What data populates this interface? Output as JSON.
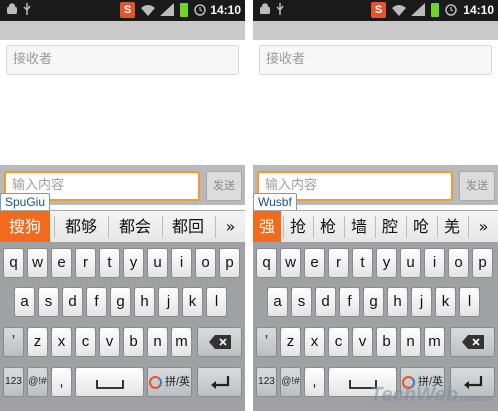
{
  "screens": [
    {
      "statusbar": {
        "sogou_label": "S",
        "time": "14:10"
      },
      "recipient_placeholder": "接收者",
      "message_placeholder": "输入内容",
      "send_label": "发送",
      "pinyin": "SpuGiu",
      "candidates": [
        "搜狗",
        "都够",
        "都会",
        "都回",
        "»"
      ],
      "keyboard": {
        "row1": [
          "q",
          "w",
          "e",
          "r",
          "t",
          "y",
          "u",
          "i",
          "o",
          "p"
        ],
        "row2": [
          "a",
          "s",
          "d",
          "f",
          "g",
          "h",
          "j",
          "k",
          "l"
        ],
        "row3": [
          "ʼ",
          "z",
          "x",
          "c",
          "v",
          "b",
          "n",
          "m"
        ],
        "row4": {
          "num": "123",
          "sym": "@!#",
          "comma": ",",
          "lang": "拼/英",
          "period": "。"
        }
      }
    },
    {
      "statusbar": {
        "sogou_label": "S",
        "time": "14:10"
      },
      "recipient_placeholder": "接收者",
      "message_placeholder": "输入内容",
      "send_label": "发送",
      "pinyin": "Wusbf",
      "candidates": [
        "强",
        "抢",
        "枪",
        "墙",
        "腔",
        "呛",
        "羌",
        "»"
      ],
      "keyboard": {
        "row1": [
          "q",
          "w",
          "e",
          "r",
          "t",
          "y",
          "u",
          "i",
          "o",
          "p"
        ],
        "row2": [
          "a",
          "s",
          "d",
          "f",
          "g",
          "h",
          "j",
          "k",
          "l"
        ],
        "row3": [
          "ʼ",
          "z",
          "x",
          "c",
          "v",
          "b",
          "n",
          "m"
        ],
        "row4": {
          "num": "123",
          "sym": "@!#",
          "comma": ",",
          "lang": "拼/英",
          "period": "。"
        }
      }
    }
  ],
  "watermark": {
    "brand": "TechWeb",
    "domain": ".com.cn"
  },
  "colors": {
    "accent_orange": "#f26b1d",
    "input_border": "#f29a2e",
    "keyboard_bg": "#9fa1a4",
    "battery": "#6fd51f"
  }
}
